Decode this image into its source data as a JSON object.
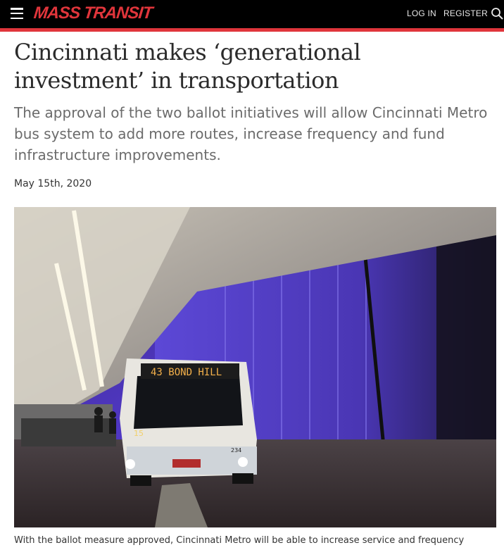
{
  "header": {
    "logo_text": "Mass Transit",
    "login_label": "LOG IN",
    "register_label": "REGISTER",
    "menu_icon": "hamburger-menu-icon",
    "search_icon": "search-icon",
    "brand_color": "#e0353b"
  },
  "article": {
    "headline": "Cincinnati makes ‘generational investment’ in transportation",
    "dek": "The approval of the two ballot initiatives will allow Cincinnati Metro bus system to add more routes, increase frequency and fund infrastructure improvements.",
    "date": "May 15th, 2020",
    "photo": {
      "bus_destination_sign": "43  BOND HILL",
      "bus_route_number": "15",
      "bus_fleet_number": "234"
    },
    "caption": "With the ballot measure approved, Cincinnati Metro will be able to increase service and frequency"
  }
}
